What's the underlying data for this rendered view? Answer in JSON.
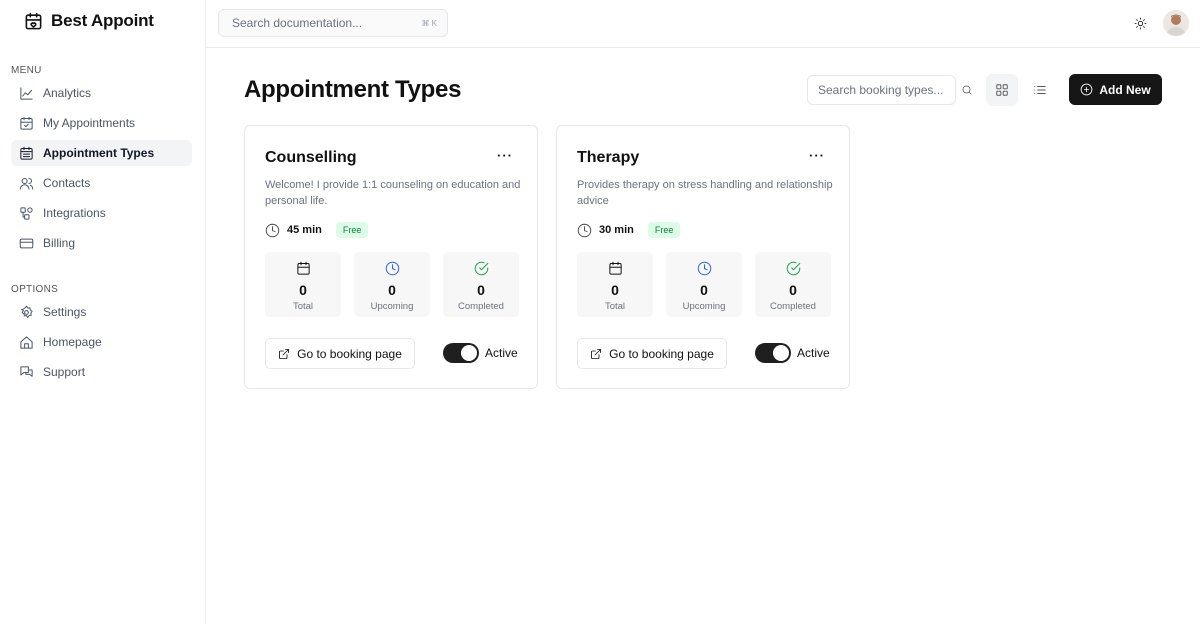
{
  "brand": {
    "name": "Best Appoint"
  },
  "sidebar": {
    "menu_label": "MENU",
    "menu_items": [
      {
        "label": "Analytics",
        "icon": "analytics-icon",
        "active": false
      },
      {
        "label": "My Appointments",
        "icon": "calendar-check-icon",
        "active": false
      },
      {
        "label": "Appointment Types",
        "icon": "calendar-list-icon",
        "active": true
      },
      {
        "label": "Contacts",
        "icon": "users-icon",
        "active": false
      },
      {
        "label": "Integrations",
        "icon": "integrations-icon",
        "active": false
      },
      {
        "label": "Billing",
        "icon": "credit-card-icon",
        "active": false
      }
    ],
    "options_label": "OPTIONS",
    "option_items": [
      {
        "label": "Settings",
        "icon": "gear-icon"
      },
      {
        "label": "Homepage",
        "icon": "home-icon"
      },
      {
        "label": "Support",
        "icon": "support-icon"
      }
    ]
  },
  "topbar": {
    "search_placeholder": "Search documentation...",
    "search_shortcut": "⌘ K"
  },
  "main": {
    "title": "Appointment Types",
    "search_placeholder": "Search booking types...",
    "add_label": "Add New"
  },
  "cards": [
    {
      "title": "Counselling",
      "description": "Welcome! I provide 1:1 counseling on education and personal life.",
      "duration": "45 min",
      "price_badge": "Free",
      "stats": {
        "total": "0",
        "total_label": "Total",
        "upcoming": "0",
        "upcoming_label": "Upcoming",
        "completed": "0",
        "completed_label": "Completed"
      },
      "booking_label": "Go to booking page",
      "status_label": "Active"
    },
    {
      "title": "Therapy",
      "description": "Provides therapy on stress handling and relationship advice",
      "duration": "30 min",
      "price_badge": "Free",
      "stats": {
        "total": "0",
        "total_label": "Total",
        "upcoming": "0",
        "upcoming_label": "Upcoming",
        "completed": "0",
        "completed_label": "Completed"
      },
      "booking_label": "Go to booking page",
      "status_label": "Active"
    }
  ],
  "colors": {
    "accent_dark": "#161616",
    "badge_bg": "#dcfce7",
    "badge_text": "#15803d",
    "upcoming_icon": "#2563eb",
    "completed_icon": "#16a34a"
  }
}
